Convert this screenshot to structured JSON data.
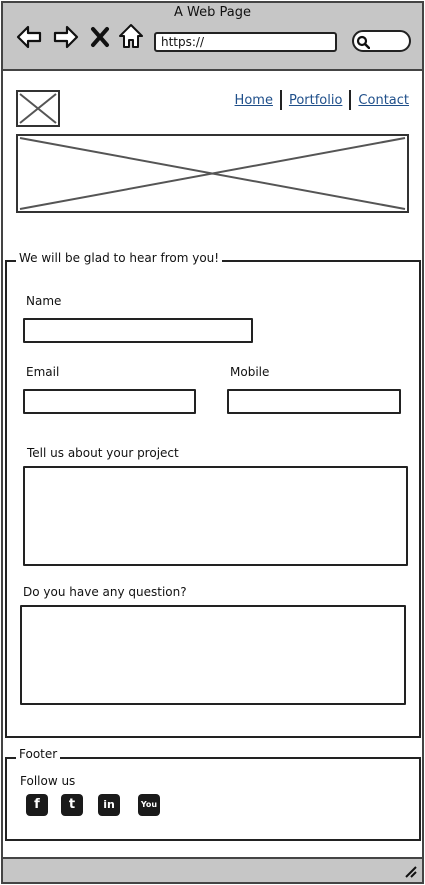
{
  "browser": {
    "title": "A Web Page",
    "url": "https://"
  },
  "nav": {
    "home": "Home",
    "portfolio": "Portfolio",
    "contact": "Contact"
  },
  "form": {
    "legend": "We will be glad to hear from you!",
    "name_label": "Name",
    "email_label": "Email",
    "mobile_label": "Mobile",
    "project_label": "Tell us about your project",
    "question_label": "Do you have any question?"
  },
  "footer": {
    "legend": "Footer",
    "follow_label": "Follow us",
    "social": [
      {
        "icon": "facebook-icon",
        "glyph": "f"
      },
      {
        "icon": "twitter-icon",
        "glyph": "t"
      },
      {
        "icon": "linkedin-icon",
        "glyph": "in"
      },
      {
        "icon": "youtube-icon",
        "glyph": "You"
      }
    ]
  }
}
